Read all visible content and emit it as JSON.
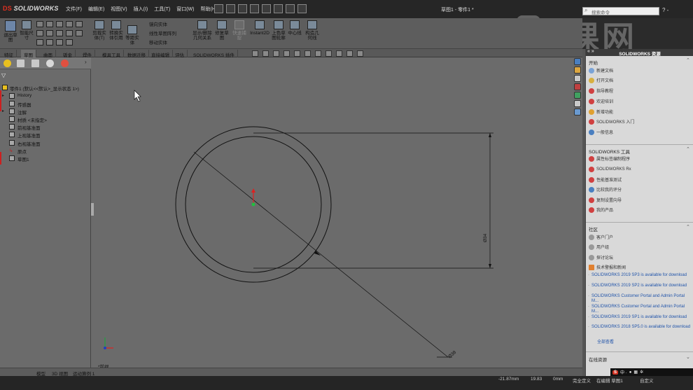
{
  "app": {
    "logo_prefix": "DS",
    "logo_text": "SOLIDWORKS",
    "window_title": "草图1 - 零件1 *"
  },
  "menu": [
    "文件(F)",
    "编辑(E)",
    "视图(V)",
    "插入(I)",
    "工具(T)",
    "窗口(W)",
    "帮助(H)"
  ],
  "search": {
    "placeholder": "搜索命令"
  },
  "help_label": "? -",
  "toolbar": {
    "exit_sketch": "退出草图",
    "smart_dimension": "智能尺寸",
    "trim": "剪裁实体(T)",
    "convert": "转换实体引用",
    "offset": "等距实体",
    "mirror": "镜向实体",
    "linear_pattern": "线性草图阵列",
    "move": "移动实体",
    "display_delete": "显示/删除几何关系",
    "repair": "修复草图",
    "quick_snaps": "快速捕捉",
    "rapid_sketch": "快速草图",
    "instant2d": "Instant2D",
    "shaded_sketch": "上色草图轮廓",
    "centerline": "中心线",
    "construction": "构造几何线"
  },
  "tabs": [
    "特征",
    "草图",
    "曲面",
    "钣金",
    "焊件",
    "模具工具",
    "数据迁移",
    "直接编辑",
    "评估",
    "SOLIDWORKS 插件"
  ],
  "feature_tree": {
    "filter_icon": "filter-icon",
    "root": "零件1 (默认<<默认>_显示状态 1>)",
    "items": [
      "History",
      "传感器",
      "注解",
      "材质 <未指定>",
      "前视基准面",
      "上视基准面",
      "右视基准面",
      "原点",
      "草图1"
    ]
  },
  "canvas": {
    "dimension_vertical": "Ø34",
    "dimension_diagonal": "Ø38",
    "view_label": "*前视"
  },
  "bottom_tabs": [
    "模型",
    "3D 视图",
    "运动算例 1"
  ],
  "status": {
    "x_coord": "-21.87mm",
    "y_coord": "19.83",
    "z_coord": "0mm",
    "state": "完全定义",
    "editing": "在编辑 草图1",
    "units": "自定义"
  },
  "taskpane": {
    "header": "SOLIDWORKS 资源",
    "nav": "« »",
    "sections": {
      "start": {
        "title": "开始",
        "items": [
          "新建文档",
          "打开文档",
          "指导教程",
          "欢迎培训",
          "新增功能",
          "SOLIDWORKS 入门",
          "一般信息"
        ]
      },
      "tools": {
        "title": "SOLIDWORKS 工具",
        "items": [
          "属性标签编制程序",
          "SOLIDWORKS Rx",
          "性能基准测试",
          "比较我的评分",
          "复制设置向导",
          "我的产品"
        ]
      },
      "community": {
        "title": "社区",
        "items": [
          "客户门户",
          "用户组",
          "探讨论坛",
          "技术警报和新闻"
        ]
      },
      "news": [
        "SOLIDWORKS 2019 SP3 is available for download",
        "SOLIDWORKS 2019 SP2 is available for download",
        "SOLIDWORKS Customer Portal and Admin Portal M...",
        "SOLIDWORKS Customer Portal and Admin Portal M...",
        "SOLIDWORKS 2019 SP1 is available for download",
        "SOLIDWORKS 2018 SP5.0 is available for download"
      ],
      "view_all": "全部查看",
      "online": {
        "title": "在线资源"
      }
    }
  },
  "tray": {
    "badge": "S",
    "text": "中 ·"
  },
  "watermark": "虎课网",
  "colors": {
    "sketch_line": "#111111",
    "origin_red": "#e02020",
    "origin_green": "#20c040",
    "brand_red": "#e03020"
  }
}
